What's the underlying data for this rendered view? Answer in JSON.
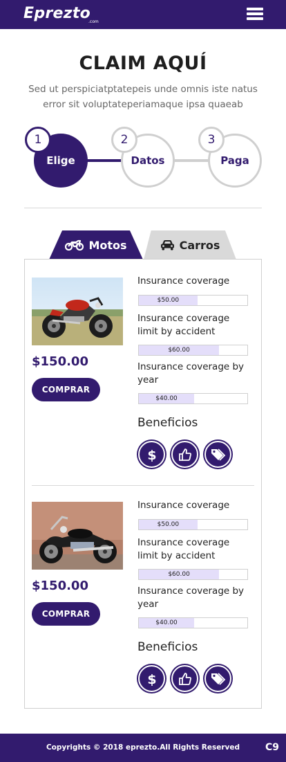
{
  "header": {
    "logo_text": "Eprezto",
    "logo_sub": ".com",
    "menu_icon": "hamburger-menu-icon"
  },
  "hero": {
    "title": "CLAIM AQUÍ",
    "subtitle": "Sed ut perspiciatptatepeis unde omnis iste natus error sit voluptateperiamaque ipsa quaeab"
  },
  "steps": [
    {
      "number": "1",
      "label": "Elige",
      "state": "active"
    },
    {
      "number": "2",
      "label": "Datos",
      "state": "inactive"
    },
    {
      "number": "3",
      "label": "Paga",
      "state": "inactive"
    }
  ],
  "tabs": [
    {
      "label": "Motos",
      "icon": "motorcycle-icon",
      "active": true
    },
    {
      "label": "Carros",
      "icon": "car-icon",
      "active": false
    }
  ],
  "colors": {
    "primary": "#321b6e",
    "bar_fill": "#e4defa",
    "inactive": "#cfcfcf",
    "tab_inactive": "#d9d9d9"
  },
  "products": [
    {
      "image": "motorcycle-photo",
      "price": "$150.00",
      "buy_label": "COMPRAR",
      "coverages": [
        {
          "label": "Insurance coverage",
          "value": "$50.00",
          "fill_fraction": 0.54
        },
        {
          "label": "Insurance coverage limit by accident",
          "value": "$60.00",
          "fill_fraction": 0.74
        },
        {
          "label": "Insurance coverage by year",
          "value": "$40.00",
          "fill_fraction": 0.51
        }
      ],
      "benefits_title": "Beneficios",
      "benefits": [
        "dollar-icon",
        "thumbs-up-icon",
        "tags-icon"
      ]
    },
    {
      "image": "cruiser-motorcycle-photo",
      "price": "$150.00",
      "buy_label": "COMPRAR",
      "coverages": [
        {
          "label": "Insurance coverage",
          "value": "$50.00",
          "fill_fraction": 0.54
        },
        {
          "label": "Insurance coverage limit by accident",
          "value": "$60.00",
          "fill_fraction": 0.74
        },
        {
          "label": "Insurance coverage by year",
          "value": "$40.00",
          "fill_fraction": 0.51
        }
      ],
      "benefits_title": "Beneficios",
      "benefits": [
        "dollar-icon",
        "thumbs-up-icon",
        "tags-icon"
      ]
    }
  ],
  "footer": {
    "copyright": "Copyrights © 2018 eprezto.All Rights Reserved",
    "badge": "C9"
  }
}
